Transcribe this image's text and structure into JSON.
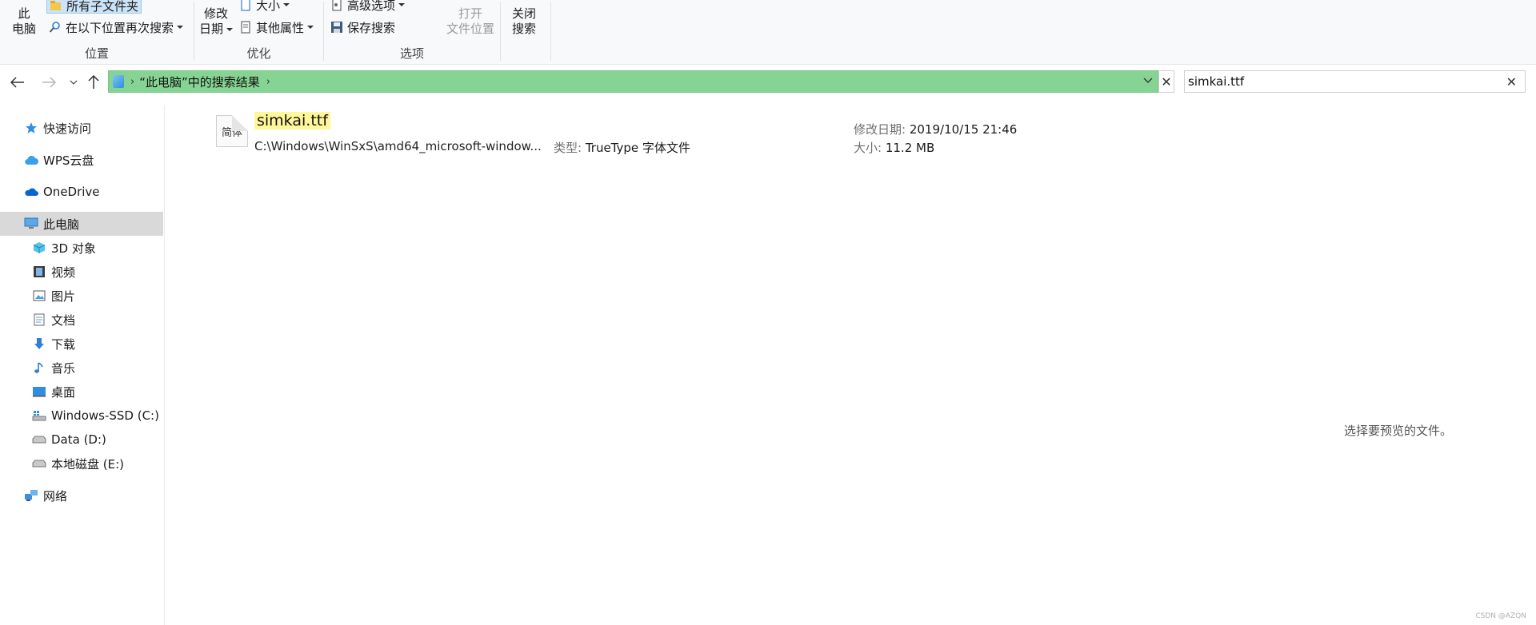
{
  "ribbon": {
    "location": {
      "this_pc_line1": "此",
      "this_pc_line2": "电脑",
      "all_subfolders": "所有子文件夹",
      "search_again": "在以下位置再次搜索",
      "label": "位置"
    },
    "refine": {
      "modified_line1": "修改",
      "modified_line2": "日期",
      "size": "大小",
      "other_props": "其他属性",
      "label": "优化"
    },
    "options": {
      "advanced": "高级选项",
      "save_search": "保存搜索",
      "open_loc_line1": "打开",
      "open_loc_line2": "文件位置",
      "label": "选项"
    },
    "close": {
      "line1": "关闭",
      "line2": "搜索"
    }
  },
  "address": {
    "breadcrumb": "“此电脑”中的搜索结果"
  },
  "search": {
    "value": "simkai.ttf"
  },
  "sidebar": {
    "items": [
      {
        "label": "快速访问",
        "icon": "star-icon"
      },
      {
        "label": "WPS云盘",
        "icon": "cloud-icon"
      },
      {
        "label": "OneDrive",
        "icon": "onedrive-icon"
      },
      {
        "label": "此电脑",
        "icon": "computer-icon"
      },
      {
        "label": "3D 对象",
        "icon": "cube-icon"
      },
      {
        "label": "视频",
        "icon": "film-icon"
      },
      {
        "label": "图片",
        "icon": "picture-icon"
      },
      {
        "label": "文档",
        "icon": "document-icon"
      },
      {
        "label": "下载",
        "icon": "download-icon"
      },
      {
        "label": "音乐",
        "icon": "music-icon"
      },
      {
        "label": "桌面",
        "icon": "desktop-icon"
      },
      {
        "label": "Windows-SSD (C:)",
        "icon": "drive-windows-icon"
      },
      {
        "label": "Data (D:)",
        "icon": "drive-icon"
      },
      {
        "label": "本地磁盘 (E:)",
        "icon": "drive-icon"
      },
      {
        "label": "网络",
        "icon": "network-icon"
      }
    ]
  },
  "result": {
    "icon_text": "简体",
    "name": "simkai.ttf",
    "path": "C:\\Windows\\WinSxS\\amd64_microsoft-window...",
    "type_key": "类型:",
    "type_value": "TrueType 字体文件",
    "date_key": "修改日期:",
    "date_value": "2019/10/15 21:46",
    "size_key": "大小:",
    "size_value": "11.2 MB"
  },
  "preview_text": "选择要预览的文件。",
  "watermark": "CSDN @AZQN",
  "colors": {
    "address_bg": "#86d493",
    "highlight": "#fff79a",
    "selected": "#d9d9d9"
  }
}
